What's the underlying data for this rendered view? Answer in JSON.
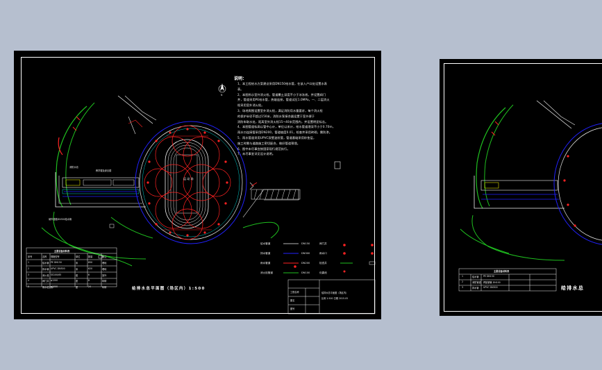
{
  "viewer": {
    "background": "#b6bfcf",
    "sheet_background": "#000000"
  },
  "main_sheet": {
    "north_label": "N",
    "notes": {
      "title": "说明：",
      "lines": [
        "1、本工程给水方案建议采用DN150给水管，在该入户口处设置水表",
        "   表。",
        "2、本图所示室外消火栓，管道覆土深度不小于冰冻线，并设置阀门",
        "   井，管道采用PE给水管，热熔连接，管道试压1.0MPa，一、二层消火",
        "   栓采用室外消火栓。",
        "3、场地周围设置室外消火栓，满足消防用水量要求，每个消火栓",
        "   的保护半径不超过150米，消防水泵接合器设置于室外便于",
        "   消防车取水处，距离室外消火栓15~40米范围内，并设置明显标志。",
        "4、本图管道标高以管中心计，单位以米计，给水管道埋深不小于0.70m，",
        "   雨水口连接管采用DN200，管道坡度0.01，检查井采用砖砌，需防渗。",
        "5、雨水管道采用UPVC双壁波纹管，管道基础采用砂垫层，",
        "   施工时需与道路施工密切配合，做好管道预埋。",
        "6、图中未尽事宜按国家现行规范执行。",
        "7、未尽事宜详见设计说明。"
      ]
    },
    "track_label": "运 动 场",
    "small_label_left": "消防水池",
    "building_label": "教学楼及综合楼",
    "road_label": "城市道路DN300给水管",
    "plan_title": "给排水总平面图（场区内）1:500",
    "table": {
      "title": "主要设备材料表",
      "headers": [
        "序号",
        "名称",
        "规格型号",
        "单位",
        "数量",
        "备注"
      ],
      "rows": [
        [
          "1",
          "给水管",
          "PE DN150",
          "米",
          "850",
          "埋地"
        ],
        [
          "2",
          "排水管",
          "UPVC DN300",
          "米",
          "620",
          "埋地"
        ],
        [
          "3",
          "消火栓",
          "SS100/65",
          "套",
          "6",
          "室外"
        ],
        [
          "4",
          "阀门井",
          "φ1200",
          "座",
          "8",
          "砖砌"
        ],
        [
          "5",
          "雨水检查井",
          "φ1000",
          "座",
          "24",
          "砖砌"
        ]
      ]
    },
    "legend": {
      "items": [
        {
          "label": "给水管道",
          "sub": "DN150"
        },
        {
          "label": "排水管道",
          "sub": "DN300"
        },
        {
          "label": "雨水管道",
          "sub": "DN200"
        },
        {
          "label": "消火栓管道",
          "sub": "DN100"
        },
        {
          "label": "阀门井",
          "sub": ""
        },
        {
          "label": "雨水口",
          "sub": ""
        },
        {
          "label": "检查井",
          "sub": ""
        },
        {
          "label": "化粪池",
          "sub": ""
        }
      ]
    },
    "title_block": {
      "rows": [
        "工程名称",
        "图名",
        "图号"
      ],
      "right_lines": [
        "给排水总平面图（场区内）",
        "比例 1:500 日期 2015.05"
      ]
    },
    "colors": {
      "water_line": "#2222ff",
      "fire_line": "#ff2222",
      "terrain": "#1fbf1f",
      "structure": "#f2f2f2",
      "accent_yellow": "#e0e000",
      "cyan": "#00cfcf",
      "magenta": "#ff33ff"
    }
  },
  "second_sheet": {
    "table_title": "主要设备材料表",
    "rows": [
      [
        "1",
        "给水管",
        "PE DN150"
      ],
      [
        "2",
        "消防管道",
        "焊接钢管 DN100"
      ],
      [
        "3",
        "排水管",
        "UPVC DN300"
      ]
    ],
    "plan_title": "给排水总"
  }
}
